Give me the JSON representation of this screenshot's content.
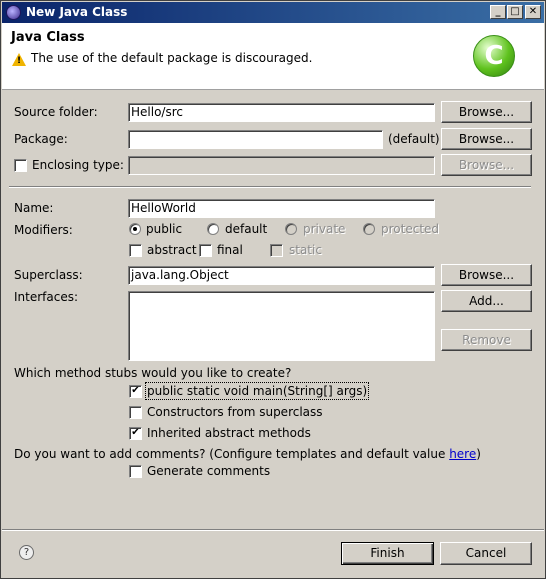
{
  "window": {
    "title": "New Java Class",
    "minimize_glyph": "_",
    "maximize_glyph": "□",
    "close_glyph": "✕"
  },
  "header": {
    "page_title": "Java Class",
    "message": "The use of the default package is discouraged.",
    "warning_icon": "warning-icon",
    "badge_icon": "class-badge-icon",
    "badge_glyph": "C"
  },
  "form": {
    "source_folder": {
      "label": "Source folder:",
      "value": "Hello/src",
      "browse_label": "Browse..."
    },
    "package": {
      "label": "Package:",
      "value": "",
      "default_hint": "(default)",
      "browse_label": "Browse..."
    },
    "enclosing_type": {
      "label": "Enclosing type:",
      "checked": false,
      "value": "",
      "browse_label": "Browse..."
    },
    "name": {
      "label": "Name:",
      "value": "HelloWorld"
    },
    "modifiers": {
      "label": "Modifiers:",
      "options": [
        {
          "label": "public",
          "selected": true,
          "enabled": true
        },
        {
          "label": "default",
          "selected": false,
          "enabled": true
        },
        {
          "label": "private",
          "selected": false,
          "enabled": false
        },
        {
          "label": "protected",
          "selected": false,
          "enabled": false
        }
      ],
      "flags": [
        {
          "label": "abstract",
          "checked": false,
          "enabled": true
        },
        {
          "label": "final",
          "checked": false,
          "enabled": true
        },
        {
          "label": "static",
          "checked": false,
          "enabled": false
        }
      ]
    },
    "superclass": {
      "label": "Superclass:",
      "value": "java.lang.Object",
      "browse_label": "Browse..."
    },
    "interfaces": {
      "label": "Interfaces:",
      "add_label": "Add...",
      "remove_label": "Remove",
      "items": []
    },
    "stubs": {
      "question": "Which method stubs would you like to create?",
      "options": [
        {
          "label": "public static void main(String[] args)",
          "checked": true
        },
        {
          "label": "Constructors from superclass",
          "checked": false
        },
        {
          "label": "Inherited abstract methods",
          "checked": true
        }
      ]
    },
    "comments": {
      "question": "Do you want to add comments? (Configure templates and default value ",
      "link_text": "here",
      "question_end": ")",
      "generate_label": "Generate comments",
      "checked": false
    }
  },
  "footer": {
    "help_icon": "help-icon",
    "help_glyph": "?",
    "finish_label": "Finish",
    "cancel_label": "Cancel"
  },
  "glyphs": {
    "check": "✔"
  }
}
